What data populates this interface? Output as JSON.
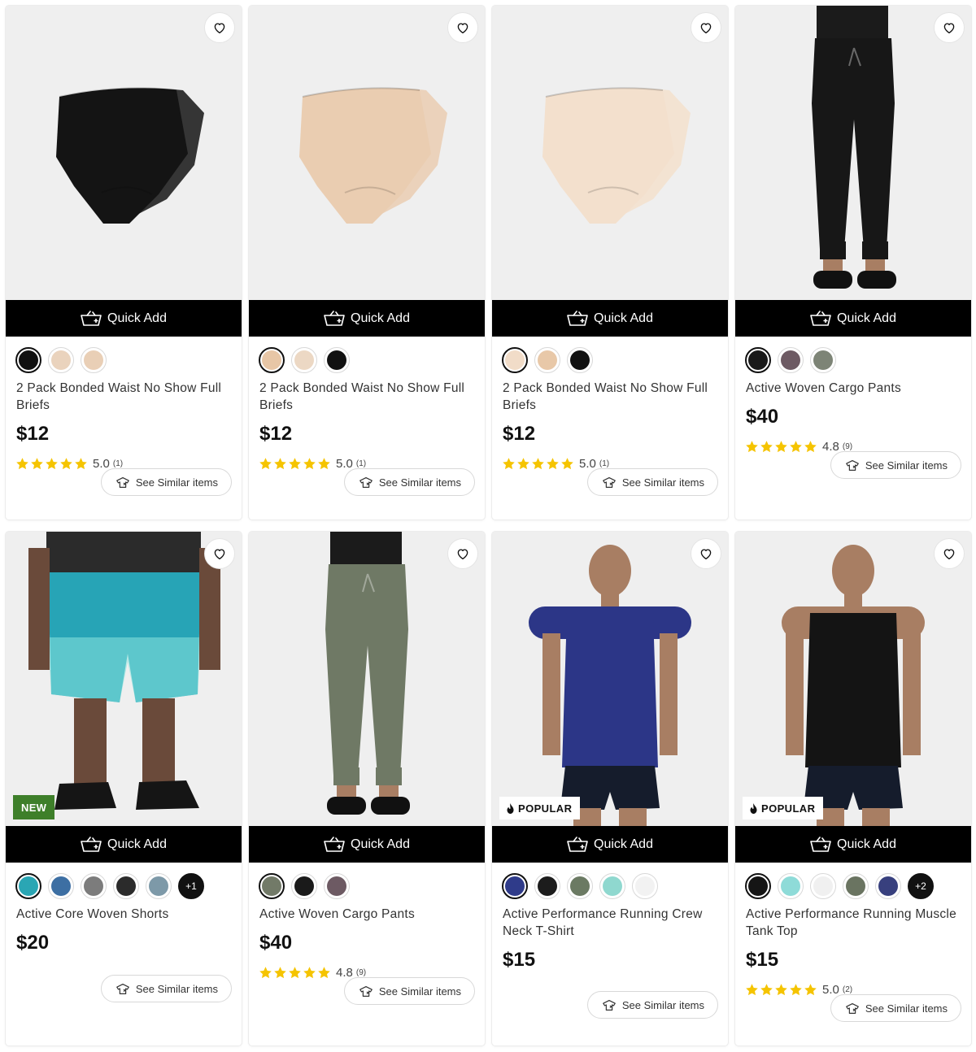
{
  "quick_add_label": "Quick Add",
  "similar_label": "See Similar items",
  "products": [
    {
      "title": "2 Pack Bonded Waist No Show Full Briefs",
      "price": "$12",
      "rating": "5.0",
      "rating_count": "(1)",
      "badge": "",
      "swatches": [
        "#111111",
        "#ead3bd",
        "#e9cfb6"
      ],
      "more": "",
      "image": "briefs",
      "color": "#141414"
    },
    {
      "title": "2 Pack Bonded Waist No Show Full Briefs",
      "price": "$12",
      "rating": "5.0",
      "rating_count": "(1)",
      "badge": "",
      "swatches": [
        "#e7c6a6",
        "#ecd8c4",
        "#111111"
      ],
      "more": "",
      "image": "briefs",
      "color": "#eacdb1"
    },
    {
      "title": "2 Pack Bonded Waist No Show Full Briefs",
      "price": "$12",
      "rating": "5.0",
      "rating_count": "(1)",
      "badge": "",
      "swatches": [
        "#f1dcc8",
        "#e8c8a8",
        "#111111"
      ],
      "more": "",
      "image": "briefs",
      "color": "#f3e0cd"
    },
    {
      "title": "Active Woven Cargo Pants",
      "price": "$40",
      "rating": "4.8",
      "rating_count": "(9)",
      "badge": "",
      "swatches": [
        "#1a1a1a",
        "#6d5a63",
        "#7d8476"
      ],
      "more": "",
      "image": "pants",
      "color": "#171717"
    },
    {
      "title": "Active Core Woven Shorts",
      "price": "$20",
      "rating": "",
      "rating_count": "",
      "badge": "NEW",
      "swatches": [
        "#2aa6b4",
        "#3d6fa3",
        "#7c7c7c",
        "#2b2b2b",
        "#7d99a8"
      ],
      "more": "+1",
      "image": "shorts",
      "color": "#27a4b6"
    },
    {
      "title": "Active Woven Cargo Pants",
      "price": "$40",
      "rating": "4.8",
      "rating_count": "(9)",
      "badge": "",
      "swatches": [
        "#727a68",
        "#1a1a1a",
        "#6d5a63"
      ],
      "more": "",
      "image": "pants",
      "color": "#6f7965"
    },
    {
      "title": "Active Performance Running Crew Neck T-Shirt",
      "price": "$15",
      "rating": "",
      "rating_count": "",
      "badge": "POPULAR",
      "swatches": [
        "#2f3b8a",
        "#1c1c1c",
        "#6b7a63",
        "#8fd8cf",
        "#f2f2f2"
      ],
      "more": "",
      "image": "tee",
      "color": "#2c3687"
    },
    {
      "title": "Active Performance Running Muscle Tank Top",
      "price": "$15",
      "rating": "5.0",
      "rating_count": "(2)",
      "badge": "POPULAR",
      "swatches": [
        "#151515",
        "#8edbd8",
        "#f0f0f0",
        "#6a7461",
        "#38407e"
      ],
      "more": "+2",
      "image": "tank",
      "color": "#141414"
    }
  ]
}
